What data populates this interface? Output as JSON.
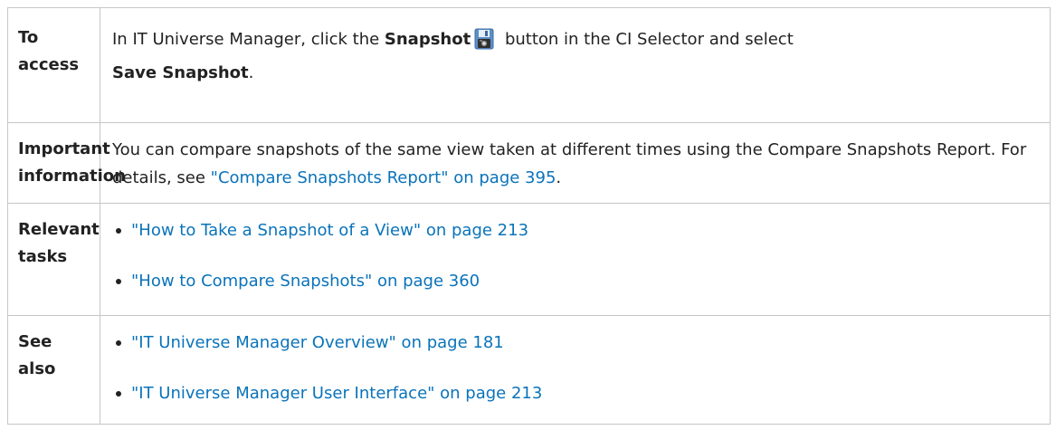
{
  "rows": {
    "access": {
      "label": "To access",
      "text_before": "In IT Universe Manager, click the ",
      "bold_snapshot": "Snapshot",
      "icon": "save-snapshot-icon",
      "text_middle": " button in the CI Selector and select",
      "bold_save": "Save Snapshot",
      "text_after": "."
    },
    "important": {
      "label": "Important information",
      "text": "You can compare snapshots of the same view taken at different times using the Compare Snapshots Report. For details, see ",
      "link": "\"Compare Snapshots Report\" on page 395",
      "text_after": "."
    },
    "tasks": {
      "label": "Relevant tasks",
      "links": [
        "\"How to Take a Snapshot of a View\" on page 213",
        "\"How to Compare Snapshots\" on page 360"
      ]
    },
    "see_also": {
      "label": "See also",
      "links": [
        "\"IT Universe Manager Overview\" on page 181",
        "\"IT Universe Manager User Interface\" on page 213"
      ]
    }
  },
  "colors": {
    "link": "#0a73ba",
    "border": "#c6c6c6",
    "text": "#222222"
  }
}
